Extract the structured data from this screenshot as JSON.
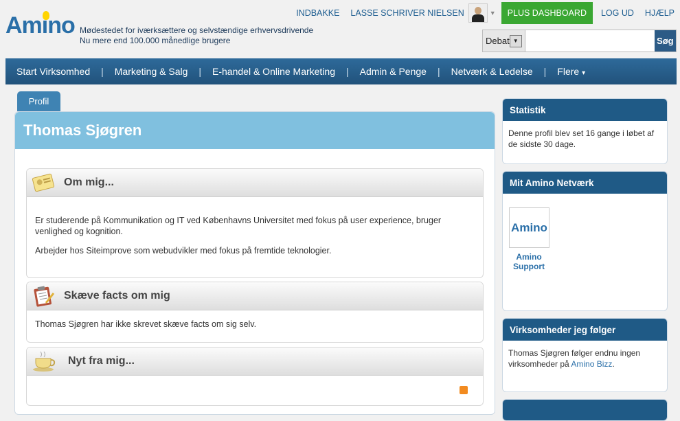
{
  "logo": {
    "text": "Amino"
  },
  "tagline": {
    "line1": "Mødestedet for iværksættere og selvstændige erhvervsdrivende",
    "line2": "Nu mere end 100.000 månedlige brugere"
  },
  "toplinks": {
    "inbox": "INDBAKKE",
    "user": "LASSE SCHRIVER NIELSEN",
    "plus_dashboard": "PLUS DASHBOARD",
    "logout": "LOG UD",
    "help": "HJÆLP"
  },
  "search": {
    "category": "Debat",
    "placeholder": "",
    "button": "Søg"
  },
  "nav": {
    "items": [
      "Start Virksomhed",
      "Marketing & Salg",
      "E-handel & Online Marketing",
      "Admin & Penge",
      "Netværk & Ledelse",
      "Flere"
    ],
    "more_caret": "▾"
  },
  "profile": {
    "tab": "Profil",
    "name": "Thomas Sjøgren"
  },
  "about": {
    "title": "Om mig...",
    "p1": "Er studerende på Kommunikation og IT ved Københavns Universitet med fokus på user experience, bruger venlighed og kognition.",
    "p2": "Arbejder hos Siteimprove som webudvikler med fokus på fremtide teknologier."
  },
  "facts": {
    "title": "Skæve facts om mig",
    "text": "Thomas Sjøgren har ikke skrevet skæve facts om sig selv."
  },
  "news": {
    "title": "Nyt fra mig..."
  },
  "sidebar": {
    "stats": {
      "title": "Statistik",
      "text": "Denne profil blev set 16 gange i løbet af de sidste 30 dage."
    },
    "network": {
      "title": "Mit Amino Netværk",
      "logo_text": "Amino",
      "member": "Amino Support"
    },
    "companies": {
      "title": "Virksomheder jeg følger",
      "text": "Thomas Sjøgren følger endnu ingen virksomheder på ",
      "link": "Amino Bizz",
      "suffix": "."
    }
  }
}
